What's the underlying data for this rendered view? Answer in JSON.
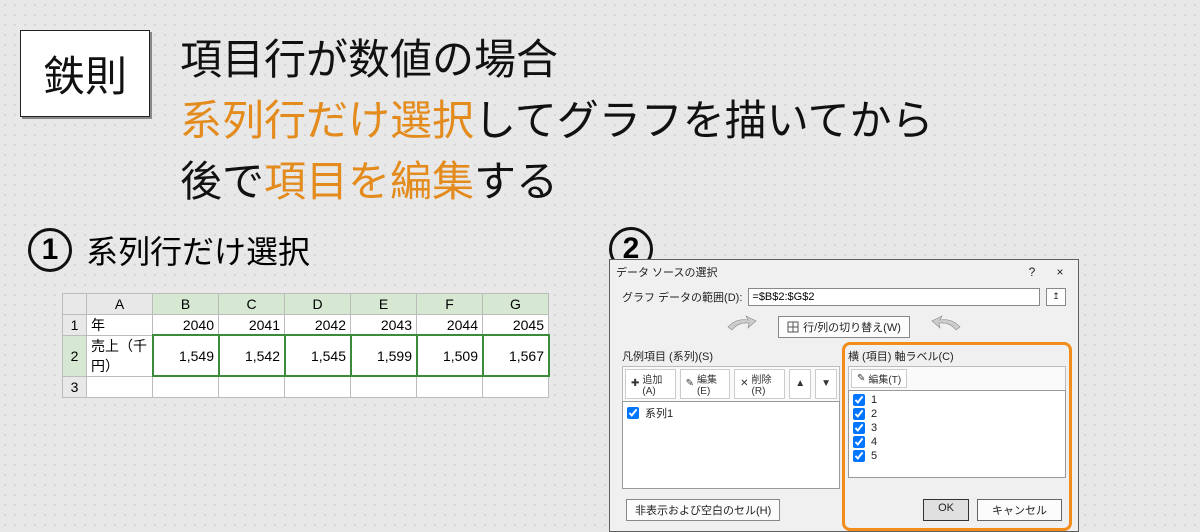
{
  "rule_badge": "鉄則",
  "headline": {
    "line1": "項目行が数値の場合",
    "line2_a": "系列行だけ選択",
    "line2_b": "してグラフを描いてから",
    "line3_a": "後で",
    "line3_b": "項目を編集",
    "line3_c": "する"
  },
  "steps": {
    "s1": {
      "num": "1",
      "title": "系列行だけ選択"
    },
    "s2": {
      "num": "2"
    }
  },
  "sheet": {
    "cols": [
      "A",
      "B",
      "C",
      "D",
      "E",
      "F",
      "G"
    ],
    "rows": [
      "1",
      "2",
      "3"
    ],
    "row1_label": "年",
    "row1_vals": [
      "2040",
      "2041",
      "2042",
      "2043",
      "2044",
      "2045"
    ],
    "row2_label": "売上（千円）",
    "row2_vals": [
      "1,549",
      "1,542",
      "1,545",
      "1,599",
      "1,509",
      "1,567"
    ]
  },
  "dialog": {
    "title": "データ ソースの選択",
    "help_glyph": "?",
    "close_glyph": "×",
    "range_label": "グラフ データの範囲(D):",
    "range_value": "=$B$2:$G$2",
    "swap_label": "行/列の切り替え(W)",
    "legend_label": "凡例項目 (系列)(S)",
    "axis_label": "横 (項目) 軸ラベル(C)",
    "legend_toolbar": {
      "add": "追加(A)",
      "edit": "編集(E)",
      "del": "削除(R)"
    },
    "legend_items": [
      "系列1"
    ],
    "axis_toolbar": {
      "edit": "編集(T)"
    },
    "axis_items": [
      "1",
      "2",
      "3",
      "4",
      "5"
    ],
    "hidden_btn": "非表示および空白のセル(H)",
    "ok": "OK",
    "cancel": "キャンセル"
  },
  "chart_data": {
    "type": "table",
    "note": "No chart plotted; screenshot shows spreadsheet rows and a Select Data Source dialog",
    "columns": [
      "年",
      "2040",
      "2041",
      "2042",
      "2043",
      "2044",
      "2045"
    ],
    "rows": [
      {
        "label": "売上（千円）",
        "values": [
          1549,
          1542,
          1545,
          1599,
          1509,
          1567
        ]
      }
    ]
  }
}
